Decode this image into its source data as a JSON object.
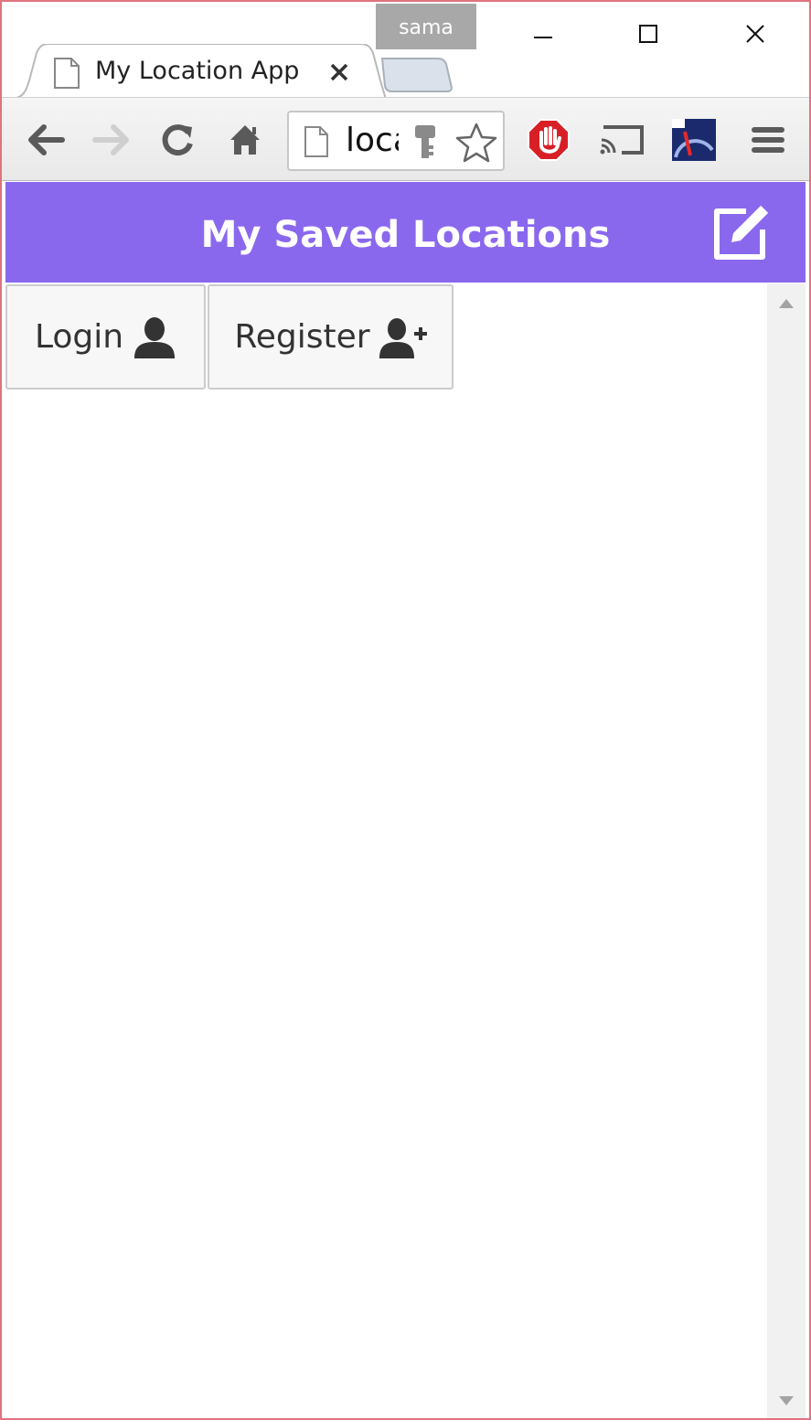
{
  "browser": {
    "profile_name": "sama",
    "tab_title": "My Location App",
    "tab_close_glyph": "×",
    "omnibox_text": "localhost",
    "icons": [
      "back-arrow-icon",
      "forward-arrow-icon",
      "reload-icon",
      "home-icon",
      "page-icon",
      "key-icon",
      "star-icon",
      "adblock-icon",
      "cast-icon",
      "speedometer-icon",
      "menu-icon"
    ]
  },
  "app": {
    "header_title": "My Saved Locations",
    "header_color": "#8a68ee",
    "buttons": {
      "login_label": "Login",
      "register_label": "Register"
    }
  }
}
